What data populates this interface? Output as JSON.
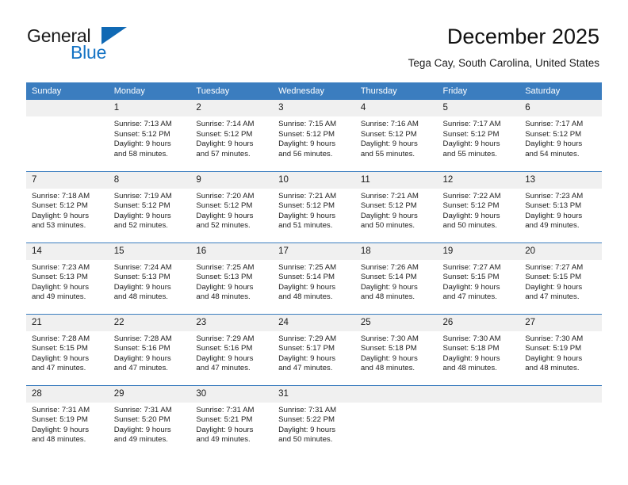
{
  "brand": {
    "name_part1": "General",
    "name_part2": "Blue",
    "logo_icon": "triangle-flag-icon"
  },
  "header": {
    "month_title": "December 2025",
    "location": "Tega Cay, South Carolina, United States"
  },
  "calendar": {
    "accent_color": "#3b7dbf",
    "daynum_bg": "#f0f0f0",
    "weekday_headers": [
      "Sunday",
      "Monday",
      "Tuesday",
      "Wednesday",
      "Thursday",
      "Friday",
      "Saturday"
    ],
    "weeks": [
      [
        {
          "day": "",
          "empty": true,
          "sunrise": "",
          "sunset": "",
          "daylight_line1": "",
          "daylight_line2": ""
        },
        {
          "day": "1",
          "empty": false,
          "sunrise": "Sunrise: 7:13 AM",
          "sunset": "Sunset: 5:12 PM",
          "daylight_line1": "Daylight: 9 hours",
          "daylight_line2": "and 58 minutes."
        },
        {
          "day": "2",
          "empty": false,
          "sunrise": "Sunrise: 7:14 AM",
          "sunset": "Sunset: 5:12 PM",
          "daylight_line1": "Daylight: 9 hours",
          "daylight_line2": "and 57 minutes."
        },
        {
          "day": "3",
          "empty": false,
          "sunrise": "Sunrise: 7:15 AM",
          "sunset": "Sunset: 5:12 PM",
          "daylight_line1": "Daylight: 9 hours",
          "daylight_line2": "and 56 minutes."
        },
        {
          "day": "4",
          "empty": false,
          "sunrise": "Sunrise: 7:16 AM",
          "sunset": "Sunset: 5:12 PM",
          "daylight_line1": "Daylight: 9 hours",
          "daylight_line2": "and 55 minutes."
        },
        {
          "day": "5",
          "empty": false,
          "sunrise": "Sunrise: 7:17 AM",
          "sunset": "Sunset: 5:12 PM",
          "daylight_line1": "Daylight: 9 hours",
          "daylight_line2": "and 55 minutes."
        },
        {
          "day": "6",
          "empty": false,
          "sunrise": "Sunrise: 7:17 AM",
          "sunset": "Sunset: 5:12 PM",
          "daylight_line1": "Daylight: 9 hours",
          "daylight_line2": "and 54 minutes."
        }
      ],
      [
        {
          "day": "7",
          "empty": false,
          "sunrise": "Sunrise: 7:18 AM",
          "sunset": "Sunset: 5:12 PM",
          "daylight_line1": "Daylight: 9 hours",
          "daylight_line2": "and 53 minutes."
        },
        {
          "day": "8",
          "empty": false,
          "sunrise": "Sunrise: 7:19 AM",
          "sunset": "Sunset: 5:12 PM",
          "daylight_line1": "Daylight: 9 hours",
          "daylight_line2": "and 52 minutes."
        },
        {
          "day": "9",
          "empty": false,
          "sunrise": "Sunrise: 7:20 AM",
          "sunset": "Sunset: 5:12 PM",
          "daylight_line1": "Daylight: 9 hours",
          "daylight_line2": "and 52 minutes."
        },
        {
          "day": "10",
          "empty": false,
          "sunrise": "Sunrise: 7:21 AM",
          "sunset": "Sunset: 5:12 PM",
          "daylight_line1": "Daylight: 9 hours",
          "daylight_line2": "and 51 minutes."
        },
        {
          "day": "11",
          "empty": false,
          "sunrise": "Sunrise: 7:21 AM",
          "sunset": "Sunset: 5:12 PM",
          "daylight_line1": "Daylight: 9 hours",
          "daylight_line2": "and 50 minutes."
        },
        {
          "day": "12",
          "empty": false,
          "sunrise": "Sunrise: 7:22 AM",
          "sunset": "Sunset: 5:12 PM",
          "daylight_line1": "Daylight: 9 hours",
          "daylight_line2": "and 50 minutes."
        },
        {
          "day": "13",
          "empty": false,
          "sunrise": "Sunrise: 7:23 AM",
          "sunset": "Sunset: 5:13 PM",
          "daylight_line1": "Daylight: 9 hours",
          "daylight_line2": "and 49 minutes."
        }
      ],
      [
        {
          "day": "14",
          "empty": false,
          "sunrise": "Sunrise: 7:23 AM",
          "sunset": "Sunset: 5:13 PM",
          "daylight_line1": "Daylight: 9 hours",
          "daylight_line2": "and 49 minutes."
        },
        {
          "day": "15",
          "empty": false,
          "sunrise": "Sunrise: 7:24 AM",
          "sunset": "Sunset: 5:13 PM",
          "daylight_line1": "Daylight: 9 hours",
          "daylight_line2": "and 48 minutes."
        },
        {
          "day": "16",
          "empty": false,
          "sunrise": "Sunrise: 7:25 AM",
          "sunset": "Sunset: 5:13 PM",
          "daylight_line1": "Daylight: 9 hours",
          "daylight_line2": "and 48 minutes."
        },
        {
          "day": "17",
          "empty": false,
          "sunrise": "Sunrise: 7:25 AM",
          "sunset": "Sunset: 5:14 PM",
          "daylight_line1": "Daylight: 9 hours",
          "daylight_line2": "and 48 minutes."
        },
        {
          "day": "18",
          "empty": false,
          "sunrise": "Sunrise: 7:26 AM",
          "sunset": "Sunset: 5:14 PM",
          "daylight_line1": "Daylight: 9 hours",
          "daylight_line2": "and 48 minutes."
        },
        {
          "day": "19",
          "empty": false,
          "sunrise": "Sunrise: 7:27 AM",
          "sunset": "Sunset: 5:15 PM",
          "daylight_line1": "Daylight: 9 hours",
          "daylight_line2": "and 47 minutes."
        },
        {
          "day": "20",
          "empty": false,
          "sunrise": "Sunrise: 7:27 AM",
          "sunset": "Sunset: 5:15 PM",
          "daylight_line1": "Daylight: 9 hours",
          "daylight_line2": "and 47 minutes."
        }
      ],
      [
        {
          "day": "21",
          "empty": false,
          "sunrise": "Sunrise: 7:28 AM",
          "sunset": "Sunset: 5:15 PM",
          "daylight_line1": "Daylight: 9 hours",
          "daylight_line2": "and 47 minutes."
        },
        {
          "day": "22",
          "empty": false,
          "sunrise": "Sunrise: 7:28 AM",
          "sunset": "Sunset: 5:16 PM",
          "daylight_line1": "Daylight: 9 hours",
          "daylight_line2": "and 47 minutes."
        },
        {
          "day": "23",
          "empty": false,
          "sunrise": "Sunrise: 7:29 AM",
          "sunset": "Sunset: 5:16 PM",
          "daylight_line1": "Daylight: 9 hours",
          "daylight_line2": "and 47 minutes."
        },
        {
          "day": "24",
          "empty": false,
          "sunrise": "Sunrise: 7:29 AM",
          "sunset": "Sunset: 5:17 PM",
          "daylight_line1": "Daylight: 9 hours",
          "daylight_line2": "and 47 minutes."
        },
        {
          "day": "25",
          "empty": false,
          "sunrise": "Sunrise: 7:30 AM",
          "sunset": "Sunset: 5:18 PM",
          "daylight_line1": "Daylight: 9 hours",
          "daylight_line2": "and 48 minutes."
        },
        {
          "day": "26",
          "empty": false,
          "sunrise": "Sunrise: 7:30 AM",
          "sunset": "Sunset: 5:18 PM",
          "daylight_line1": "Daylight: 9 hours",
          "daylight_line2": "and 48 minutes."
        },
        {
          "day": "27",
          "empty": false,
          "sunrise": "Sunrise: 7:30 AM",
          "sunset": "Sunset: 5:19 PM",
          "daylight_line1": "Daylight: 9 hours",
          "daylight_line2": "and 48 minutes."
        }
      ],
      [
        {
          "day": "28",
          "empty": false,
          "sunrise": "Sunrise: 7:31 AM",
          "sunset": "Sunset: 5:19 PM",
          "daylight_line1": "Daylight: 9 hours",
          "daylight_line2": "and 48 minutes."
        },
        {
          "day": "29",
          "empty": false,
          "sunrise": "Sunrise: 7:31 AM",
          "sunset": "Sunset: 5:20 PM",
          "daylight_line1": "Daylight: 9 hours",
          "daylight_line2": "and 49 minutes."
        },
        {
          "day": "30",
          "empty": false,
          "sunrise": "Sunrise: 7:31 AM",
          "sunset": "Sunset: 5:21 PM",
          "daylight_line1": "Daylight: 9 hours",
          "daylight_line2": "and 49 minutes."
        },
        {
          "day": "31",
          "empty": false,
          "sunrise": "Sunrise: 7:31 AM",
          "sunset": "Sunset: 5:22 PM",
          "daylight_line1": "Daylight: 9 hours",
          "daylight_line2": "and 50 minutes."
        },
        {
          "day": "",
          "empty": true,
          "sunrise": "",
          "sunset": "",
          "daylight_line1": "",
          "daylight_line2": ""
        },
        {
          "day": "",
          "empty": true,
          "sunrise": "",
          "sunset": "",
          "daylight_line1": "",
          "daylight_line2": ""
        },
        {
          "day": "",
          "empty": true,
          "sunrise": "",
          "sunset": "",
          "daylight_line1": "",
          "daylight_line2": ""
        }
      ]
    ]
  }
}
